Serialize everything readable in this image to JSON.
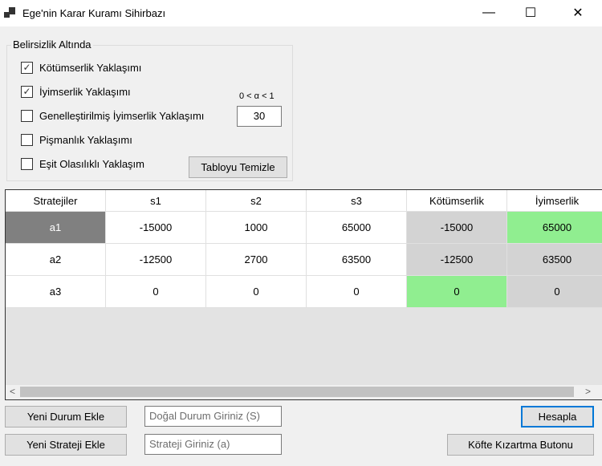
{
  "window": {
    "title": "Ege'nin Karar Kuramı Sihirbazı",
    "minimize": "—",
    "maximize": "☐",
    "close": "✕"
  },
  "group": {
    "title": "Belirsizlik Altında",
    "options": [
      {
        "label": "Kötümserlik Yaklaşımı",
        "checked": true
      },
      {
        "label": "İyimserlik Yaklaşımı",
        "checked": true
      },
      {
        "label": "Genelleştirilmiş İyimserlik Yaklaşımı",
        "checked": false
      },
      {
        "label": "Pişmanlık Yaklaşımı",
        "checked": false
      },
      {
        "label": "Eşit Olasılıklı Yaklaşım",
        "checked": false
      }
    ],
    "alpha_label": "0 < α < 1",
    "alpha_value": "30",
    "clear_button": "Tabloyu Temizle"
  },
  "grid": {
    "headers": [
      "Stratejiler",
      "s1",
      "s2",
      "s3",
      "Kötümserlik",
      "İyimserlik"
    ],
    "rows": [
      [
        "a1",
        "-15000",
        "1000",
        "65000",
        "-15000",
        "65000"
      ],
      [
        "a2",
        "-12500",
        "2700",
        "63500",
        "-12500",
        "63500"
      ],
      [
        "a3",
        "0",
        "0",
        "0",
        "0",
        "0"
      ]
    ],
    "scroll_left": "<",
    "scroll_right": ">"
  },
  "bottom": {
    "add_state_button": "Yeni Durum Ekle",
    "state_placeholder": "Doğal Durum Giriniz (S)",
    "add_strategy_button": "Yeni Strateji Ekle",
    "strategy_placeholder": "Strateji Giriniz (a)",
    "calculate_button": "Hesapla",
    "kofte_button": "Köfte Kızartma Butonu"
  },
  "colors": {
    "highlight": "#90ee90",
    "computed": "#d3d3d3",
    "selected": "#808080"
  }
}
